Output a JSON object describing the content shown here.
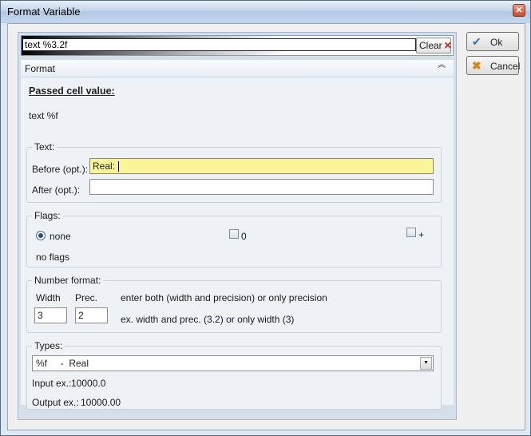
{
  "window": {
    "title": "Format Variable",
    "close_glyph": "✕"
  },
  "format_string": {
    "value": "text %3.2f",
    "clear_label": "Clear",
    "clear_glyph": "✕"
  },
  "format_section": {
    "label": "Format",
    "collapse_glyph": "︽"
  },
  "passed_cell": {
    "title": "Passed cell value:",
    "value": "text %f"
  },
  "text_group": {
    "legend": "Text:",
    "before_label": "Before (opt.):",
    "before_value": "Real: ",
    "after_label": "After (opt.):",
    "after_value": ""
  },
  "flags_group": {
    "legend": "Flags:",
    "none_label": "none",
    "zero_label": "0",
    "plus_label": "+",
    "selected": "none",
    "description": "no flags"
  },
  "number_group": {
    "legend": "Number format:",
    "width_label": "Width",
    "prec_label": "Prec.",
    "width_value": "3",
    "prec_value": "2",
    "hint_top": "enter both (width and precision) or only precision",
    "hint_bottom": "ex. width and prec. (3.2) or only width (3)"
  },
  "types_group": {
    "legend": "Types:",
    "selected": "%f     -  Real",
    "input_ex_label": "Input ex.:",
    "input_ex_value": "10000.0",
    "output_ex_label": "Output ex.:",
    "output_ex_value": "10000.00"
  },
  "buttons": {
    "ok_label": "Ok",
    "cancel_label": "Cancel"
  },
  "icons": {
    "ok": "check-icon",
    "cancel": "x-icon"
  }
}
